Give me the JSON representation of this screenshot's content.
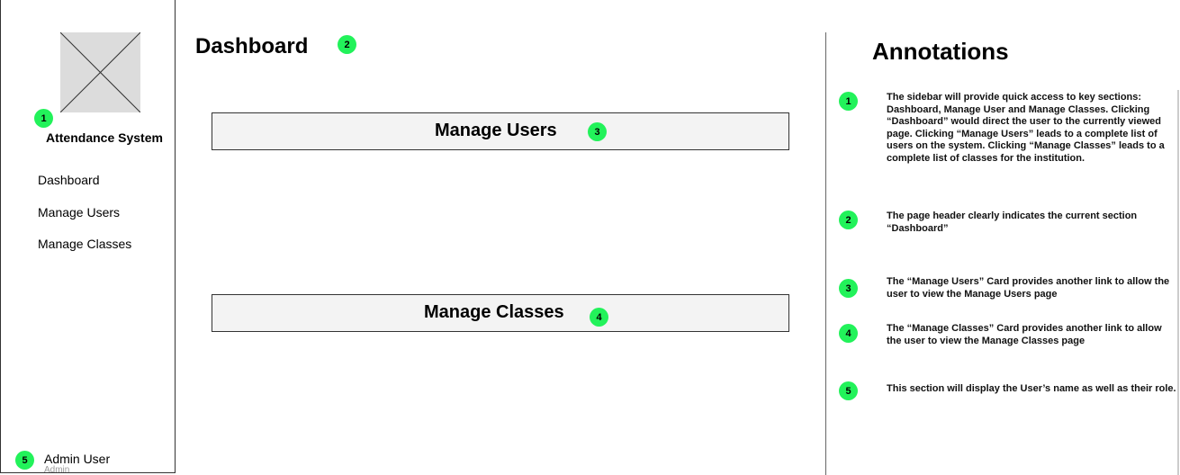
{
  "sidebar": {
    "app_title": "Attendance System",
    "nav": [
      "Dashboard",
      "Manage Users",
      "Manage Classes"
    ],
    "user": {
      "name": "Admin User",
      "role": "Admin"
    }
  },
  "main": {
    "title": "Dashboard",
    "cards": [
      "Manage Users",
      "Manage Classes"
    ]
  },
  "annotations": {
    "title": "Annotations",
    "items": [
      {
        "number": "1",
        "text": "The sidebar will provide quick access to key sections: Dashboard, Manage User and Manage Classes. Clicking “Dashboard” would direct the user to the currently viewed page. Clicking “Manage Users” leads to a complete list of users on the system. Clicking “Manage Classes” leads to a complete list of classes for the institution."
      },
      {
        "number": "2",
        "text": "The page header clearly indicates the current section “Dashboard”"
      },
      {
        "number": "3",
        "text": "The “Manage Users” Card provides another link to allow the user to view the Manage Users page"
      },
      {
        "number": "4",
        "text": "The “Manage Classes” Card provides another link to allow the user to view the Manage Classes page"
      },
      {
        "number": "5",
        "text": "This section will display the User’s name as well as their role."
      }
    ]
  },
  "colors": {
    "badge": "#22f25a",
    "card_bg": "#f3f3f3",
    "placeholder": "#dcdcdc"
  }
}
